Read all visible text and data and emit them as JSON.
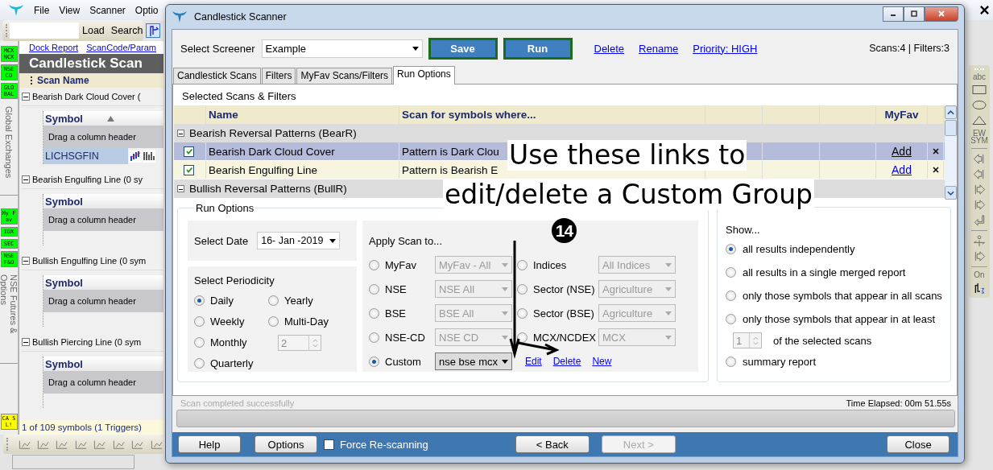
{
  "app": {
    "menu": [
      "File",
      "View",
      "Scanner",
      "Optio"
    ],
    "toolbar_buttons": [
      "Load",
      "Search"
    ],
    "side_groups": [
      {
        "tiles": [
          {
            "label": "MCX NCX",
            "color": "#00ff00"
          },
          {
            "label": "NSE CD",
            "color": "#00ff00"
          },
          {
            "label": "GLO BAL",
            "color": "#00ff00"
          }
        ],
        "caption": "Global Exchanges"
      },
      {
        "tiles": [
          {
            "label": "My Fav",
            "color": "#00ff00"
          },
          {
            "label": "IDX",
            "color": "#00ff00"
          },
          {
            "label": "SEC",
            "color": "#00ff00"
          },
          {
            "label": "NSE F&O",
            "color": "#00ff00"
          }
        ],
        "caption": "NSE Futures & Options"
      },
      {
        "tiles": [
          {
            "label": "CA SL!",
            "color": "#ffff00"
          }
        ]
      }
    ],
    "links": [
      "Dock Report",
      "ScanCode/Param"
    ],
    "title": "Candlestick Scan",
    "column": "Scan Name",
    "groups": [
      {
        "title": "Bearish Dark Cloud Cover (",
        "symbol_header": "Symbol",
        "hint": "Drag a column header",
        "rows": [
          "LICHSGFIN"
        ]
      },
      {
        "title": "Bearish Engulfing Line (0 sy",
        "symbol_header": "Symbol",
        "hint": "Drag a column header"
      },
      {
        "title": "Bullish Engulfing Line (0 sym",
        "symbol_header": "Symbol",
        "hint": "Drag a column header"
      },
      {
        "title": "Bullish Piercing Line (0 sym",
        "symbol_header": "Symbol",
        "hint": "Drag a column header"
      }
    ],
    "status": "1 of 109 symbols (1 Triggers)",
    "draw_tools": [
      {
        "kind": "text",
        "label": "abc"
      },
      {
        "kind": "rect"
      },
      {
        "kind": "ellipse"
      },
      {
        "kind": "triangle"
      },
      {
        "kind": "text",
        "label": "EW SYM"
      },
      {
        "kind": "sep"
      },
      {
        "kind": "arrow-left"
      },
      {
        "kind": "arrow-left"
      },
      {
        "kind": "arrow-right"
      },
      {
        "kind": "arrow-right"
      },
      {
        "kind": "arrow-return"
      },
      {
        "kind": "sep"
      },
      {
        "kind": "timer"
      },
      {
        "kind": "arrow-right"
      },
      {
        "kind": "sep"
      },
      {
        "kind": "text",
        "label": "On"
      },
      {
        "kind": "replay"
      }
    ]
  },
  "dialog": {
    "title": "Candlestick Scanner",
    "screener": {
      "label": "Select Screener",
      "value": "Example"
    },
    "buttons": [
      "Save",
      "Run"
    ],
    "links": [
      "Delete",
      "Rename",
      "Priority: HIGH"
    ],
    "counts": "Scans:4 | Filters:3",
    "tabs": [
      {
        "label": "Candlestick Scans",
        "selected": false
      },
      {
        "label": "Filters",
        "selected": false
      },
      {
        "label": "MyFav Scans/Filters",
        "selected": false
      },
      {
        "label": "Run Options",
        "selected": true
      }
    ],
    "selected_label": "Selected Scans & Filters",
    "table": {
      "columns": [
        "Name",
        "Scan for symbols where...",
        "MyFav"
      ],
      "groups": [
        {
          "title": "Bearish Reversal Patterns (BearR)",
          "rows": [
            {
              "name": "Bearish Dark Cloud Cover",
              "condition": "Pattern is Dark Clou",
              "checked": true,
              "selected": true,
              "link": "Add"
            },
            {
              "name": "Bearish Engulfing Line",
              "condition": "Pattern is Bearish E",
              "checked": true,
              "selected": false,
              "link": "Add"
            }
          ]
        },
        {
          "title": "Bullish Reversal Patterns (BullR)"
        }
      ]
    },
    "run_options": {
      "legend": "Run Options",
      "date_label": "Select Date",
      "date": "16- Jan -2019",
      "periodicity_label": "Select Periodicity",
      "periodicity_columns": [
        [
          {
            "label": "Daily",
            "selected": true
          },
          {
            "label": "Weekly",
            "selected": false
          },
          {
            "label": "Monthly",
            "selected": false
          },
          {
            "label": "Quarterly",
            "selected": false
          }
        ],
        [
          {
            "label": "Yearly",
            "selected": false
          },
          {
            "label": "Multi-Day",
            "selected": false
          }
        ]
      ],
      "multi_day_count": "2",
      "apply_label": "Apply Scan to...",
      "apply": [
        {
          "label": "MyFav",
          "value": "MyFav - All",
          "selected": false
        },
        {
          "label": "Indices",
          "value": "All Indices",
          "selected": false
        },
        {
          "label": "NSE",
          "value": "NSE All",
          "selected": false
        },
        {
          "label": "Sector (NSE)",
          "value": "Agriculture",
          "selected": false
        },
        {
          "label": "BSE",
          "value": "BSE All",
          "selected": false
        },
        {
          "label": "Sector (BSE)",
          "value": "Agriculture",
          "selected": false
        },
        {
          "label": "NSE-CD",
          "value": "NSE CD",
          "selected": false
        },
        {
          "label": "MCX/NCDEX",
          "value": "MCX",
          "selected": false
        },
        {
          "label": "Custom",
          "value": "nse bse mcx",
          "selected": true
        }
      ],
      "custom_links": [
        "Edit",
        "Delete",
        "New"
      ]
    },
    "show": {
      "legend": "Show...",
      "options": [
        {
          "label": "all results independently",
          "selected": true
        },
        {
          "label": "all results in a single merged report",
          "selected": false
        },
        {
          "label": "only those symbols that appear in all scans",
          "selected": false
        },
        {
          "label": "only those symbols that appear in at least",
          "selected": false
        },
        {
          "label": "summary report",
          "selected": false
        }
      ],
      "min_scans": "1",
      "min_scans_suffix": "of the selected scans"
    },
    "status": "Scan completed successfully",
    "elapsed": "Time Elapsed: 00m 51.55s",
    "progress": {
      "level": 0
    },
    "footer": {
      "help": "Help",
      "options": "Options",
      "force": {
        "label": "Force Re-scanning",
        "checked": false
      },
      "nav": [
        {
          "label": "< Back",
          "disabled": false
        },
        {
          "label": "Next >",
          "disabled": true
        }
      ],
      "close": "Close"
    }
  },
  "annotation": {
    "lines": [
      "Use these links to",
      "edit/delete a Custom Group"
    ],
    "badge": "14"
  }
}
